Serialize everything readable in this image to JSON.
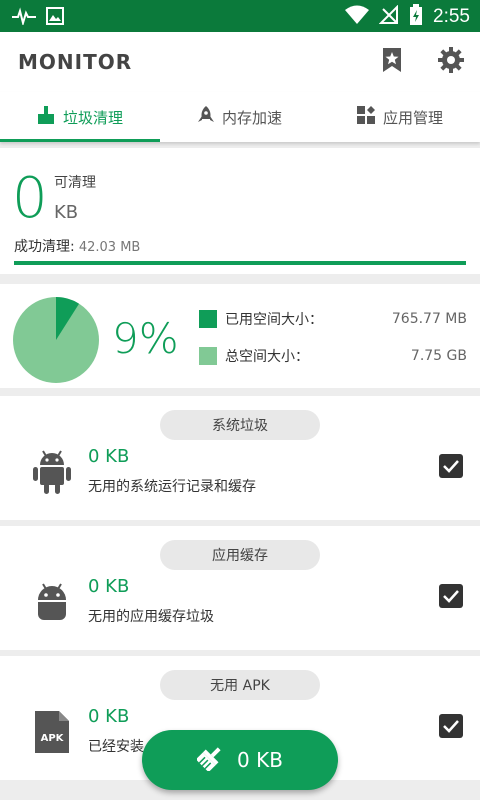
{
  "statusbar": {
    "time": "2:55",
    "icons": [
      "pulse-icon",
      "image-icon",
      "wifi-icon",
      "no-signal-icon",
      "battery-charging-icon"
    ]
  },
  "appbar": {
    "title": "MONITOR",
    "actions": [
      "bookmark-icon",
      "gear-icon"
    ]
  },
  "tabs": [
    {
      "label": "垃圾清理",
      "icon": "broom-icon",
      "active": true
    },
    {
      "label": "内存加速",
      "icon": "rocket-icon",
      "active": false
    },
    {
      "label": "应用管理",
      "icon": "apps-grid-icon",
      "active": false
    }
  ],
  "clean": {
    "number": "0",
    "label": "可清理",
    "unit": "KB",
    "success_label": "成功清理:",
    "success_value": " 42.03 MB",
    "progress_fraction": 1.0
  },
  "storage": {
    "percent": "9%",
    "used_fraction": 0.09,
    "used_label": "已用空间大小：",
    "used_value": "765.77 MB",
    "total_label": "总空间大小：",
    "total_value": "7.75 GB",
    "colors": {
      "used": "#0f9d58",
      "total": "#81c995"
    }
  },
  "categories": [
    {
      "title": "系统垃圾",
      "size": "0 KB",
      "desc": "无用的系统运行记录和缓存",
      "icon": "android-icon",
      "checked": true
    },
    {
      "title": "应用缓存",
      "size": "0 KB",
      "desc": "无用的应用缓存垃圾",
      "icon": "android-head-icon",
      "checked": true
    },
    {
      "title": "无用 APK",
      "size": "0 KB",
      "desc": "已经安装",
      "icon": "apk-file-icon",
      "icon_label": "APK",
      "checked": true
    }
  ],
  "fab": {
    "label": "0 KB",
    "icon": "broom-icon"
  },
  "colors": {
    "accent": "#0f9d58",
    "statusbar": "#0b7a3b"
  }
}
